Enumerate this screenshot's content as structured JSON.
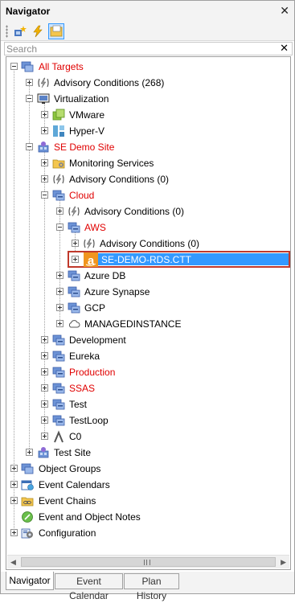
{
  "window": {
    "title": "Navigator"
  },
  "search": {
    "placeholder": "Search"
  },
  "toolbar": {
    "buttons": [
      "add-target-icon",
      "lightning-icon",
      "folder-note-icon"
    ]
  },
  "tree": {
    "all_targets": "All Targets",
    "advisory_root": "Advisory Conditions (268)",
    "virtualization": "Virtualization",
    "vmware": "VMware",
    "hyperv": "Hyper-V",
    "se_demo_site": "SE Demo Site",
    "monitoring_services": "Monitoring Services",
    "advisory_site": "Advisory Conditions (0)",
    "cloud": "Cloud",
    "advisory_cloud": "Advisory Conditions (0)",
    "aws": "AWS",
    "advisory_aws": "Advisory Conditions (0)",
    "se_demo_rds": "SE-DEMO-RDS.CTT",
    "azure_db": "Azure DB",
    "azure_synapse": "Azure Synapse",
    "gcp": "GCP",
    "managedinstance": "MANAGEDINSTANCE",
    "development": "Development",
    "eureka": "Eureka",
    "production": "Production",
    "ssas": "SSAS",
    "test": "Test",
    "testloop": "TestLoop",
    "c0": "C0",
    "test_site": "Test Site",
    "object_groups": "Object Groups",
    "event_calendars": "Event Calendars",
    "event_chains": "Event Chains",
    "event_object_notes": "Event and Object Notes",
    "configuration": "Configuration"
  },
  "tabs": [
    "Navigator",
    "Event Calendar",
    "Plan History"
  ],
  "colors": {
    "alert": "#e00000",
    "selection": "#3399ff",
    "highlight_border": "#c0392b"
  }
}
